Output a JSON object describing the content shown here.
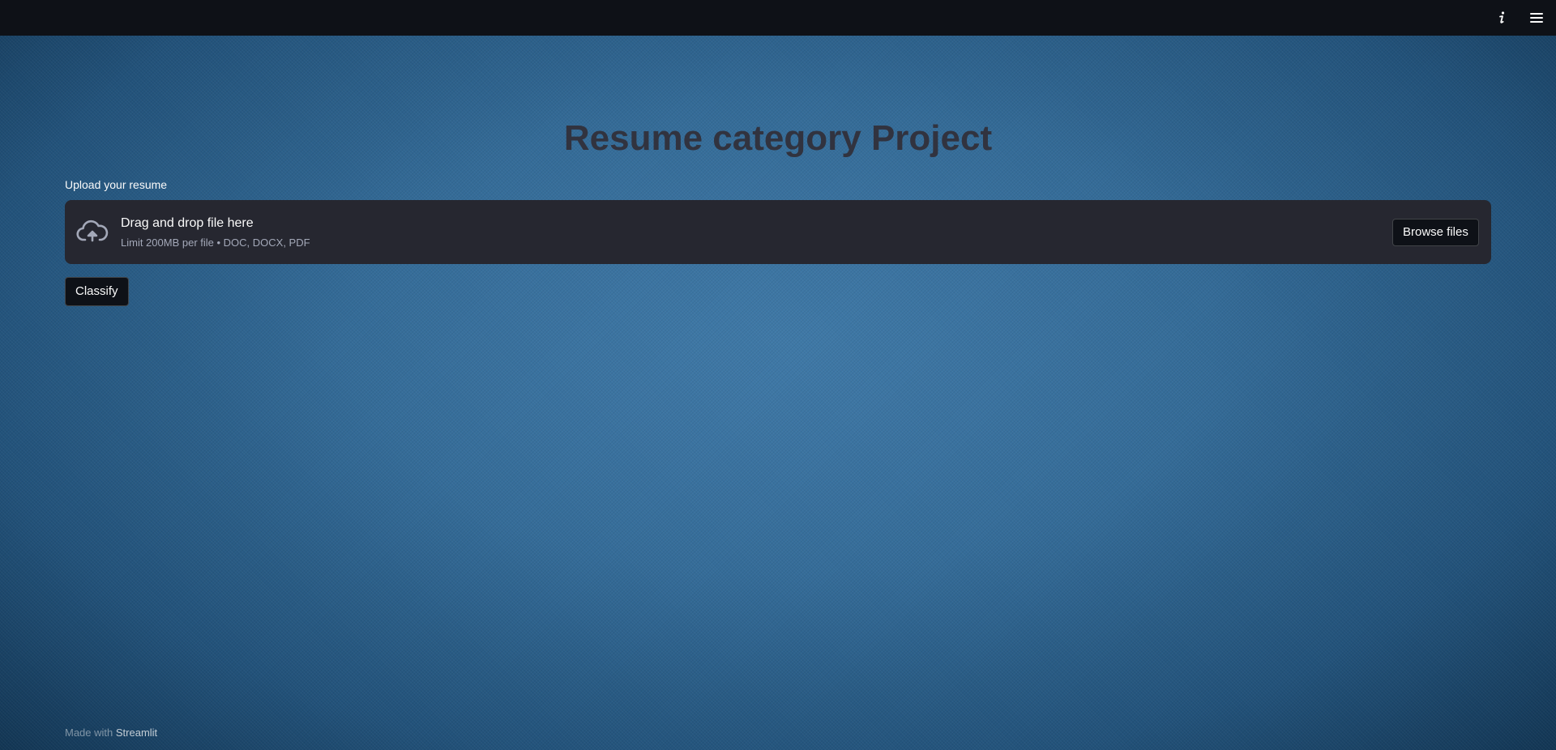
{
  "header": {
    "info_icon": "info-icon",
    "menu_icon": "hamburger-menu-icon"
  },
  "main": {
    "title": "Resume category Project",
    "uploader": {
      "label": "Upload your resume",
      "drop_text": "Drag and drop file here",
      "limit_text": "Limit 200MB per file • DOC, DOCX, PDF",
      "browse_label": "Browse files",
      "icon": "cloud-upload-icon"
    },
    "classify_label": "Classify"
  },
  "footer": {
    "prefix": "Made with",
    "link_text": "Streamlit"
  },
  "colors": {
    "topbar": "#0e1117",
    "dropzone": "#262730",
    "title_text": "#31333f",
    "background": "#336a96"
  }
}
